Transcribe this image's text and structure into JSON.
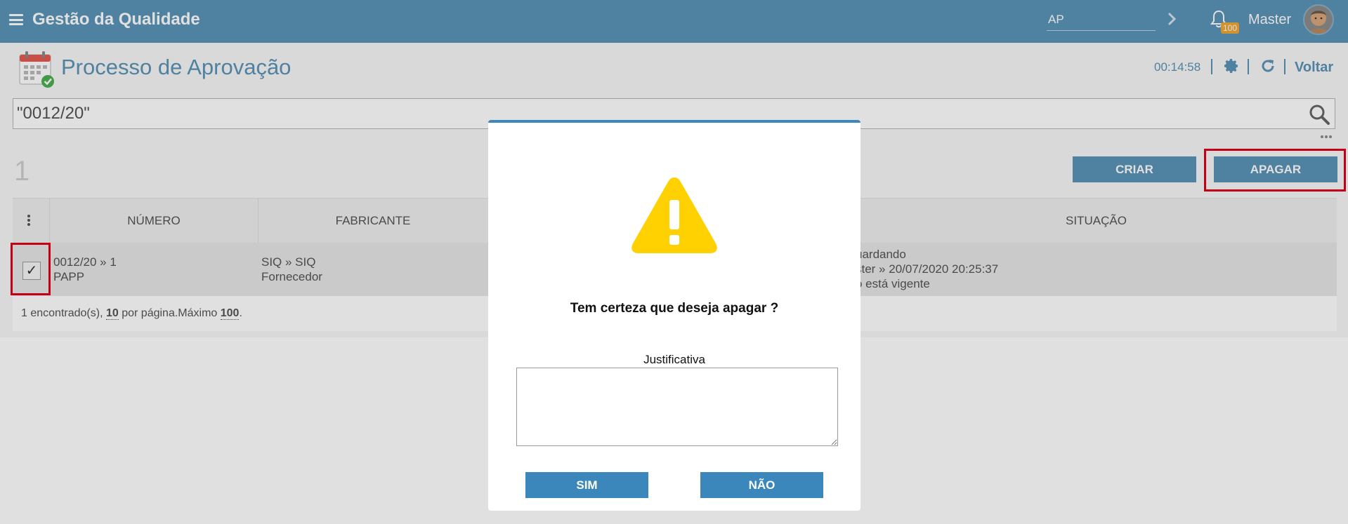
{
  "topbar": {
    "app_title": "Gestão da Qualidade",
    "search_value": "AP",
    "notifications_count": "100",
    "user_name": "Master"
  },
  "page": {
    "title": "Processo de Aprovação",
    "timer": "00:14:58",
    "back_label": "Voltar",
    "search_value": "\"0012/20\"",
    "result_count": "1",
    "create_label": "CRIAR",
    "delete_label": "APAGAR"
  },
  "table": {
    "headers": {
      "numero": "NÚMERO",
      "fabricante": "FABRICANTE",
      "situacao": "SITUAÇÃO"
    },
    "rows": [
      {
        "checked": "✓",
        "numero_line1": "0012/20 » 1",
        "numero_line2": "PAPP",
        "fabricante_line1": "SIQ » SIQ",
        "fabricante_line2": "Fornecedor",
        "situacao_line1": "uardando",
        "situacao_line2": "ster » 20/07/2020 20:25:37",
        "situacao_line3": "o está vigente"
      }
    ],
    "footer": {
      "found": "1 encontrado(s),",
      "per_page": "10",
      "per_page_label": "por página.Máximo",
      "max": "100",
      "end": "."
    }
  },
  "modal": {
    "question": "Tem certeza que deseja apagar ?",
    "justification_label": "Justificativa",
    "justification_value": "",
    "yes_label": "SIM",
    "no_label": "NÃO"
  },
  "colors": {
    "brand": "#5b93b7",
    "modal_button": "#3b86bb",
    "warning": "#ffd100",
    "highlight": "#e1001a"
  }
}
